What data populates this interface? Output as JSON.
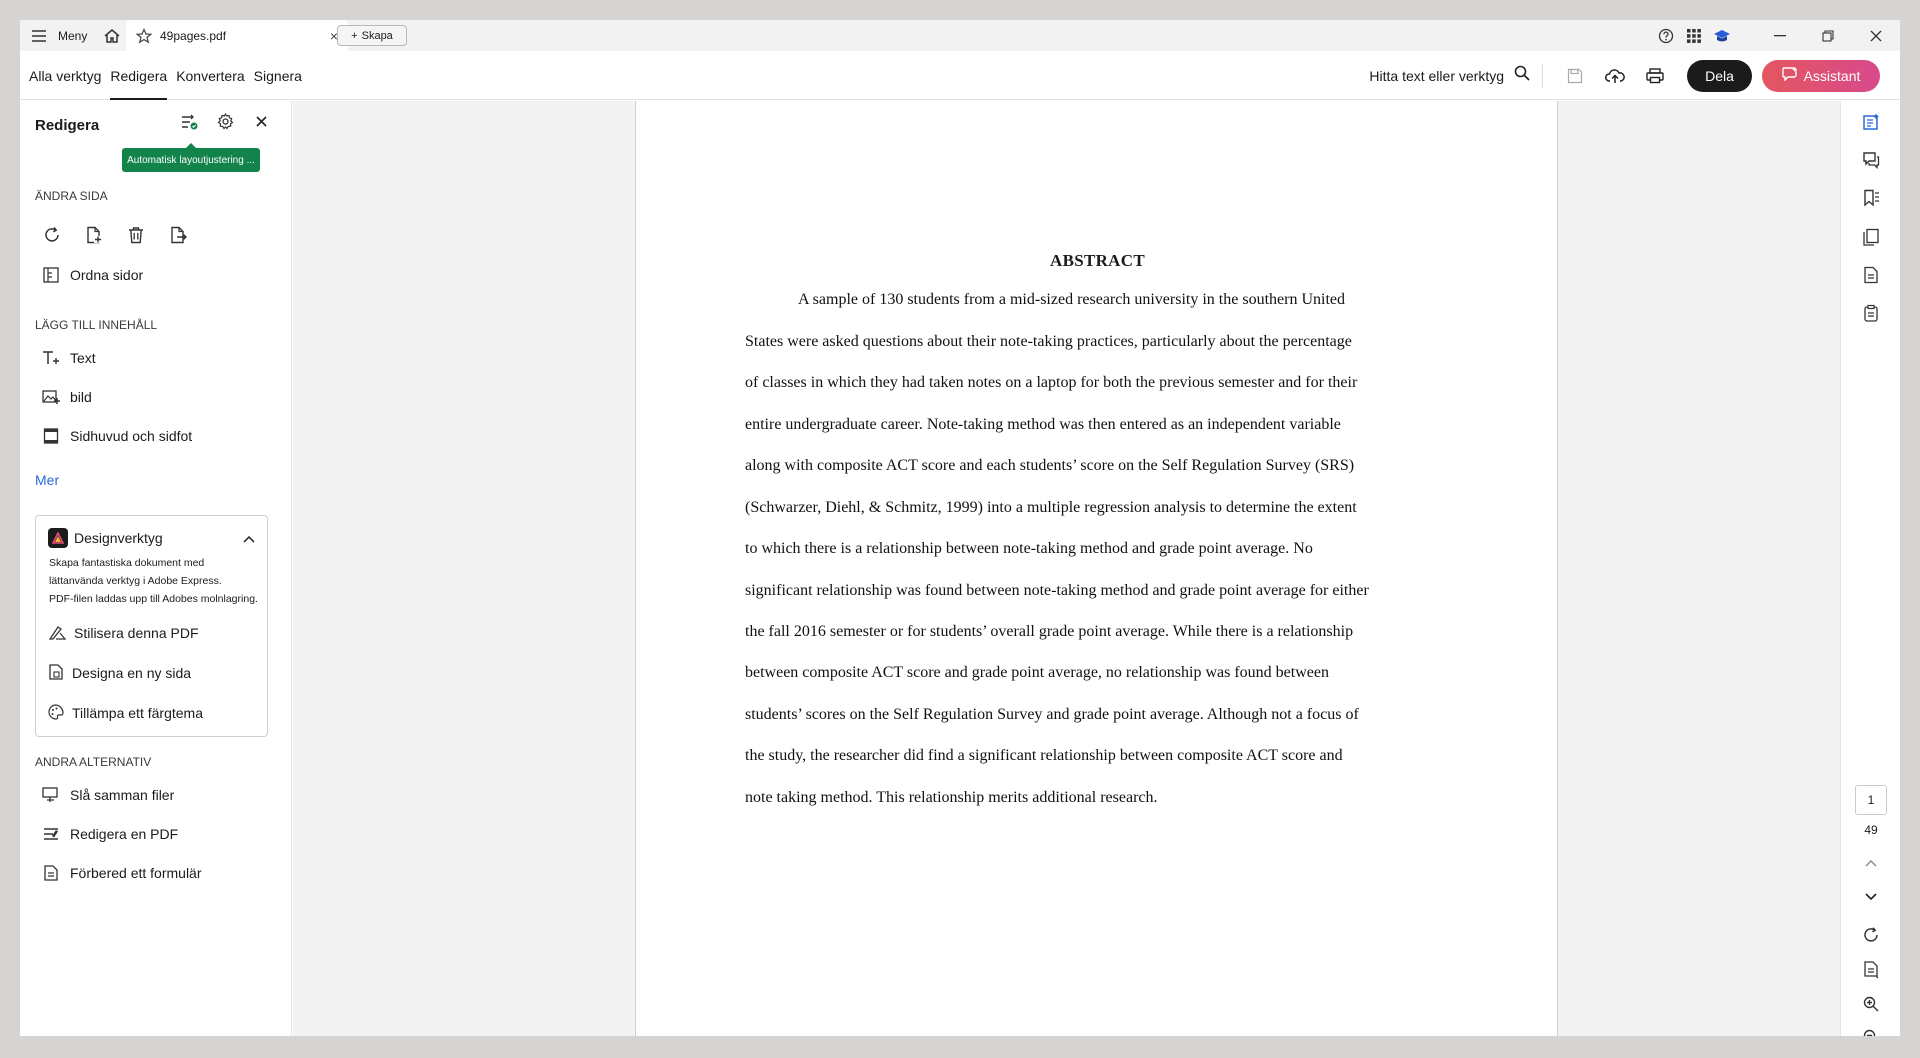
{
  "titlebar": {
    "menu_label": "Meny",
    "tab_title": "49pages.pdf",
    "tab_close": "×",
    "create_label": "Skapa"
  },
  "toolbar": {
    "tabs": [
      {
        "label": "Alla verktyg",
        "active": false
      },
      {
        "label": "Redigera",
        "active": true
      },
      {
        "label": "Konvertera",
        "active": false
      },
      {
        "label": "Signera",
        "active": false
      }
    ],
    "find_label": "Hitta text eller verktyg",
    "share_label": "Dela",
    "assistant_label": "Assistant",
    "assistant_color": "#e4565e"
  },
  "left_panel": {
    "title": "Redigera",
    "tooltip": "Automatisk layoutjustering ...",
    "section_change_page": "ÄNDRA SIDA",
    "organize_pages": "Ordna sidor",
    "section_add_content": "LÄGG TILL INNEHÅLL",
    "add_items": [
      "Text",
      "bild",
      "Sidhuvud och sidfot"
    ],
    "more_label": "Mer",
    "design_tools": {
      "title": "Designverktyg",
      "description": [
        "Skapa fantastiska dokument med",
        "lättanvända verktyg i Adobe Express.",
        "PDF-filen laddas upp till Adobes molnlagring."
      ],
      "items": [
        "Stilisera denna PDF",
        "Designa en ny sida",
        "Tillämpa ett färgtema"
      ]
    },
    "section_other": "ANDRA ALTERNATIV",
    "other_items": [
      "Slå samman filer",
      "Redigera en PDF",
      "Förbered ett formulär"
    ]
  },
  "document": {
    "heading": "ABSTRACT",
    "lines": [
      "A sample of 130 students from a mid-sized research university in the southern United",
      "States were asked questions about their note-taking practices, particularly about the percentage",
      "of classes in which they had taken notes on a laptop for both the previous semester and for their",
      "entire undergraduate career.  Note-taking method was then entered as an independent variable",
      "along with composite ACT score and each students’ score on the Self Regulation Survey (SRS)",
      "(Schwarzer, Diehl, & Schmitz, 1999) into a multiple regression analysis to determine the extent",
      "to which there is a relationship between note-taking method and grade point average.  No",
      "significant relationship was found between note-taking method and grade point average for either",
      "the fall 2016 semester or for students’ overall grade point average.  While there is a relationship",
      "between composite ACT score and grade point average, no relationship was found between",
      "students’ scores on the Self Regulation Survey and grade point average. Although not a focus of",
      "the study, the researcher did find a significant relationship between composite ACT score and",
      "note taking method.  This relationship merits additional research."
    ]
  },
  "page_nav": {
    "current_page": "1",
    "total_pages": "49"
  }
}
